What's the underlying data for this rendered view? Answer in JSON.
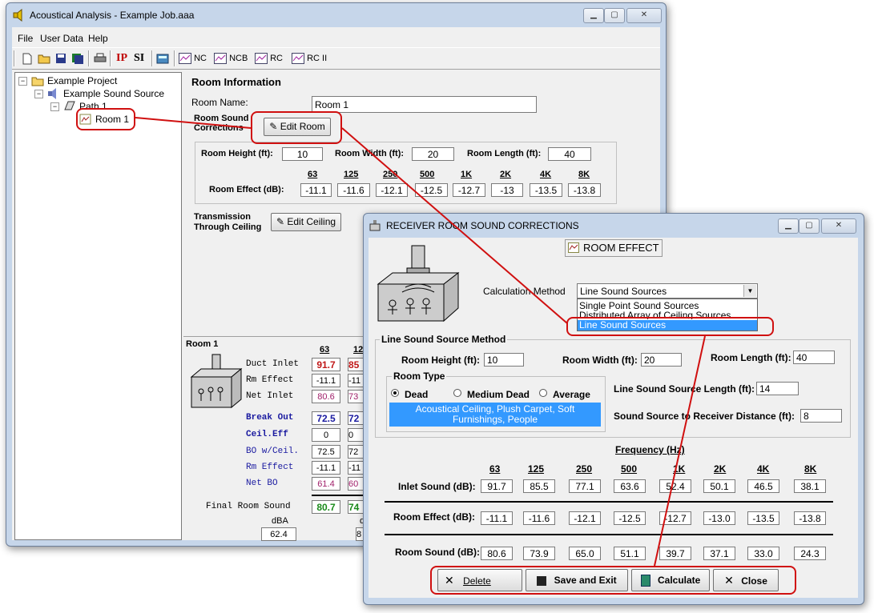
{
  "main_window": {
    "title": "Acoustical Analysis - Example Job.aaa",
    "menu": [
      "File",
      "User Data",
      "Help"
    ],
    "toolbar": {
      "ip": "IP",
      "si": "SI",
      "nc": "NC",
      "ncb": "NCB",
      "rc": "RC",
      "rc2": "RC II"
    },
    "tree": [
      "Example Project",
      "Example Sound Source",
      "Path 1",
      "Room 1"
    ],
    "room_info": {
      "heading": "Room Information",
      "name_label": "Room Name:",
      "name_value": "Room 1",
      "corrections_label_1": "Room Sound",
      "corrections_label_2": "Corrections",
      "edit_room": "Edit Room",
      "height_label": "Room Height (ft):",
      "height": "10",
      "width_label": "Room Width (ft):",
      "width": "20",
      "length_label": "Room Length (ft):",
      "length": "40",
      "freq_headers": [
        "63",
        "125",
        "250",
        "500",
        "1K",
        "2K",
        "4K",
        "8K"
      ],
      "effect_label": "Room Effect (dB):",
      "effect_values": [
        "-11.1",
        "-11.6",
        "-12.1",
        "-12.5",
        "-12.7",
        "-13",
        "-13.5",
        "-13.8"
      ],
      "transmission_1": "Transmission",
      "transmission_2": "Through Ceiling",
      "edit_ceiling": "Edit Ceiling"
    },
    "summary": {
      "room_title": "Room 1",
      "col_headers": [
        "63",
        "12"
      ],
      "rows": [
        {
          "label": "Duct Inlet",
          "v1": "91.7",
          "v2": "85"
        },
        {
          "label": "Rm Effect",
          "v1": "-11.1",
          "v2": "-11"
        },
        {
          "label": "Net Inlet",
          "v1": "80.6",
          "v2": "73"
        },
        {
          "label": "Break Out",
          "v1": "72.5",
          "v2": "72"
        },
        {
          "label": "Ceil.Eff",
          "v1": "0",
          "v2": "0"
        },
        {
          "label": "BO w/Ceil.",
          "v1": "72.5",
          "v2": "72"
        },
        {
          "label": "Rm Effect",
          "v1": "-11.1",
          "v2": "-11"
        },
        {
          "label": "Net BO",
          "v1": "61.4",
          "v2": "60"
        }
      ],
      "final_label": "Final Room Sound",
      "final_v1": "80.7",
      "final_v2": "74",
      "dba_label": "dBA",
      "dba_value": "62.4",
      "second_label": "d",
      "second_value": "8"
    }
  },
  "dialog": {
    "title": "RECEIVER ROOM SOUND CORRECTIONS",
    "room_effect_tab": "ROOM EFFECT",
    "calc_method_label": "Calculation Method",
    "calc_method_value": "Line Sound Sources",
    "options": [
      "Single Point Sound Sources",
      "Distributed Array of Ceiling Sources",
      "Line Sound Sources"
    ],
    "group_title": "Line Sound Source Method",
    "height_label": "Room Height (ft):",
    "height": "10",
    "width_label": "Room Width (ft):",
    "width": "20",
    "length_label": "Room Length (ft):",
    "length": "40",
    "room_type_title": "Room Type",
    "room_types": [
      "Dead",
      "Medium Dead",
      "Average"
    ],
    "room_type_desc": "Acoustical Ceiling, Plush Carpet, Soft Furnishings, People",
    "line_length_label": "Line Sound Source Length (ft):",
    "line_length": "14",
    "distance_label": "Sound Source to Receiver Distance (ft):",
    "distance": "8",
    "freq_title": "Frequency (Hz)",
    "freq_headers": [
      "63",
      "125",
      "250",
      "500",
      "1K",
      "2K",
      "4K",
      "8K"
    ],
    "inlet_label": "Inlet Sound (dB):",
    "inlet_values": [
      "91.7",
      "85.5",
      "77.1",
      "63.6",
      "52.4",
      "50.1",
      "46.5",
      "38.1"
    ],
    "effect_label": "Room Effect (dB):",
    "effect_values": [
      "-11.1",
      "-11.6",
      "-12.1",
      "-12.5",
      "-12.7",
      "-13.0",
      "-13.5",
      "-13.8"
    ],
    "sound_label": "Room Sound (dB):",
    "sound_values": [
      "80.6",
      "73.9",
      "65.0",
      "51.1",
      "39.7",
      "37.1",
      "33.0",
      "24.3"
    ],
    "buttons": {
      "delete": "Delete",
      "save": "Save and Exit",
      "calculate": "Calculate",
      "close": "Close"
    }
  },
  "colors": {
    "highlight": "#d01010",
    "selection": "#3399ff",
    "net_inlet": "#a0206a",
    "break_out": "#1a1aa0",
    "final": "#1a8a1a",
    "duct_inlet": "#c01818"
  }
}
